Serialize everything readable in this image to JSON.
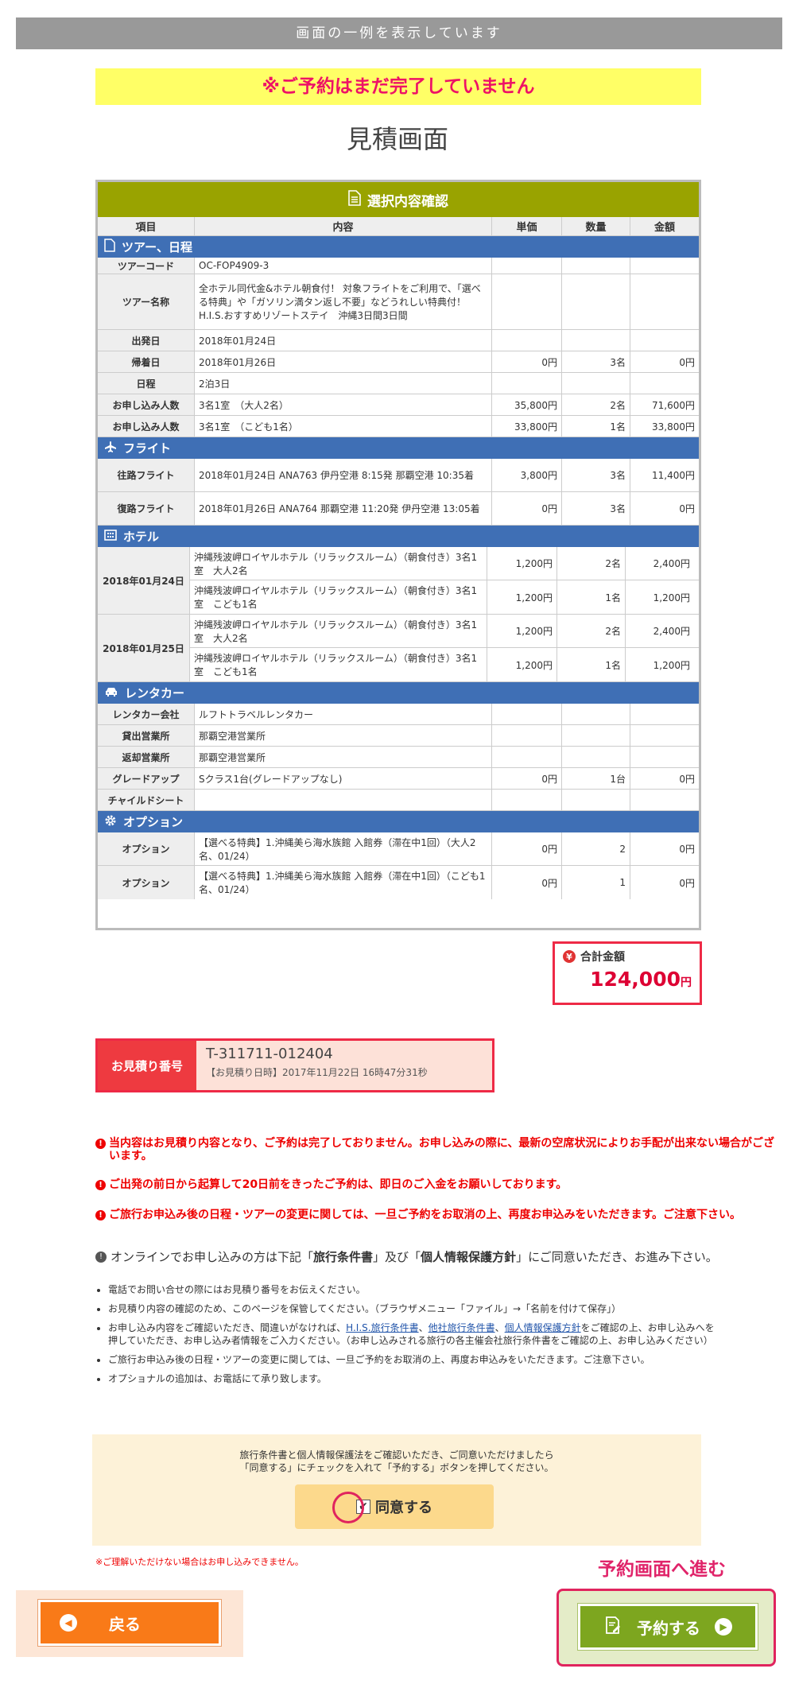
{
  "top_banner": "画面の一例を表示しています",
  "notice": "※ご予約はまだ完了していません",
  "page_title": "見積画面",
  "table": {
    "header": "選択内容確認",
    "columns": [
      "項目",
      "内容",
      "単価",
      "数量",
      "金額"
    ],
    "tour": {
      "title": "ツアー、日程",
      "rows": [
        {
          "label": "ツアーコード",
          "content": "OC-FOP4909-3",
          "unit": "",
          "qty": "",
          "amount": ""
        },
        {
          "label": "ツアー名称",
          "content": "全ホテル同代金&ホテル朝食付！ 対象フライトをご利用で、「選べる特典」や「ガソリン満タン返し不要」などうれしい特典付！ H.I.S.おすすめリゾートステイ　沖縄3日間3日間",
          "unit": "",
          "qty": "",
          "amount": ""
        },
        {
          "label": "出発日",
          "content": "2018年01月24日",
          "unit": "",
          "qty": "",
          "amount": ""
        },
        {
          "label": "帰着日",
          "content": "2018年01月26日",
          "unit": "0円",
          "qty": "3名",
          "amount": "0円"
        },
        {
          "label": "日程",
          "content": "2泊3日",
          "unit": "",
          "qty": "",
          "amount": ""
        },
        {
          "label": "お申し込み人数",
          "content": "3名1室　（大人2名）",
          "unit": "35,800円",
          "qty": "2名",
          "amount": "71,600円"
        },
        {
          "label": "お申し込み人数",
          "content": "3名1室　（こども1名）",
          "unit": "33,800円",
          "qty": "1名",
          "amount": "33,800円"
        }
      ]
    },
    "flight": {
      "title": "フライト",
      "rows": [
        {
          "label": "往路フライト",
          "content": "2018年01月24日 ANA763 伊丹空港 8:15発 那覇空港 10:35着",
          "unit": "3,800円",
          "qty": "3名",
          "amount": "11,400円"
        },
        {
          "label": "復路フライト",
          "content": "2018年01月26日 ANA764 那覇空港 11:20発 伊丹空港 13:05着",
          "unit": "0円",
          "qty": "3名",
          "amount": "0円"
        }
      ]
    },
    "hotel": {
      "title": "ホテル",
      "groups": [
        {
          "date": "2018年01月24日",
          "rows": [
            {
              "content": "沖縄残波岬ロイヤルホテル（リラックスルーム）（朝食付き）3名1室　大人2名",
              "unit": "1,200円",
              "qty": "2名",
              "amount": "2,400円"
            },
            {
              "content": "沖縄残波岬ロイヤルホテル（リラックスルーム）（朝食付き）3名1室　こども1名",
              "unit": "1,200円",
              "qty": "1名",
              "amount": "1,200円"
            }
          ]
        },
        {
          "date": "2018年01月25日",
          "rows": [
            {
              "content": "沖縄残波岬ロイヤルホテル（リラックスルーム）（朝食付き）3名1室　大人2名",
              "unit": "1,200円",
              "qty": "2名",
              "amount": "2,400円"
            },
            {
              "content": "沖縄残波岬ロイヤルホテル（リラックスルーム）（朝食付き）3名1室　こども1名",
              "unit": "1,200円",
              "qty": "1名",
              "amount": "1,200円"
            }
          ]
        }
      ]
    },
    "rental": {
      "title": "レンタカー",
      "rows": [
        {
          "label": "レンタカー会社",
          "content": "ルフトトラベルレンタカー",
          "unit": "",
          "qty": "",
          "amount": ""
        },
        {
          "label": "貸出営業所",
          "content": "那覇空港営業所",
          "unit": "",
          "qty": "",
          "amount": ""
        },
        {
          "label": "返却営業所",
          "content": "那覇空港営業所",
          "unit": "",
          "qty": "",
          "amount": ""
        },
        {
          "label": "グレードアップ",
          "content": "Sクラス1台(グレードアップなし)",
          "unit": "0円",
          "qty": "1台",
          "amount": "0円"
        },
        {
          "label": "チャイルドシート",
          "content": "",
          "unit": "",
          "qty": "",
          "amount": ""
        }
      ]
    },
    "option": {
      "title": "オプション",
      "rows": [
        {
          "label": "オプション",
          "content": "【選べる特典】1.沖縄美ら海水族館 入館券（滞在中1回）（大人2名、01/24）",
          "unit": "0円",
          "qty": "2",
          "amount": "0円"
        },
        {
          "label": "オプション",
          "content": "【選べる特典】1.沖縄美ら海水族館 入館券（滞在中1回）（こども1名、01/24）",
          "unit": "0円",
          "qty": "1",
          "amount": "0円"
        }
      ]
    }
  },
  "total": {
    "label": "合計金額",
    "amount": "124,000",
    "unit": "円"
  },
  "quote": {
    "label": "お見積り番号",
    "number": "T-311711-012404",
    "date": "【お見積り日時】2017年11月22日 16時47分31秒"
  },
  "warnings": [
    "当内容はお見積り内容となり、ご予約は完了しておりません。お申し込みの際に、最新の空席状況によりお手配が出来ない場合がございます。",
    "ご出発の前日から起算して20日前をきったご予約は、即日のご入金をお願いしております。",
    "ご旅行お申込み後の日程・ツアーの変更に関しては、一旦ご予約をお取消の上、再度お申込みをいただきます。ご注意下さい。"
  ],
  "info": {
    "pre": "オンラインでお申し込みの方は下記「",
    "b1": "旅行条件書",
    "mid": "」及び「",
    "b2": "個人情報保護方針",
    "post": "」にご同意いただき、お進み下さい。"
  },
  "bullets": [
    "電話でお問い合せの際にはお見積り番号をお伝えください。",
    "お見積り内容の確認のため、このページを保管してください。（ブラウザメニュー「ファイル」→「名前を付けて保存」）",
    "ご旅行お申込み後の日程・ツアーの変更に関しては、一旦ご予約をお取消の上、再度お申込みをいただきます。ご注意下さい。",
    "オプショナルの追加は、お電話にて承り致します。"
  ],
  "bullet3": {
    "pre": "お申し込み内容をご確認いただき、間違いがなければ、",
    "link1": "H.I.S.旅行条件書",
    "sep1": "、",
    "link2": "他社旅行条件書",
    "sep2": "、",
    "link3": "個人情報保護方針",
    "post": "をご確認の上、お申し込みへを押していただき、お申し込み者情報をご入力ください。（お申し込みされる旅行の各主催会社旅行条件書をご確認の上、お申し込みください）"
  },
  "agree": {
    "line1": "旅行条件書と個人情報保護法をご確認いただき、ご同意いただけましたら",
    "line2": "「同意する」にチェックを入れて「予約する」ボタンを押してください。",
    "label": "同意する"
  },
  "note_red": "※ご理解いただけない場合はお申し込みできません。",
  "next_label": "予約画面へ進む",
  "back_button": "戻る",
  "reserve_button": "予約する"
}
